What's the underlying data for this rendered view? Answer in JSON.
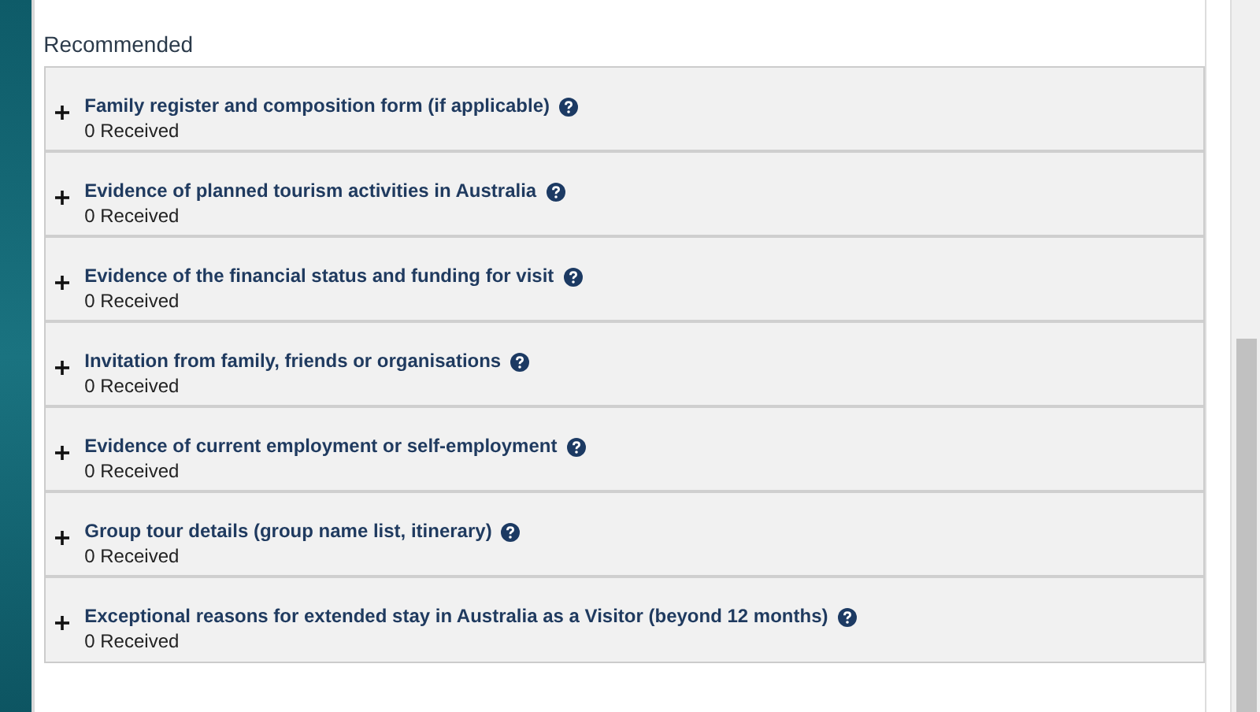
{
  "section": {
    "heading": "Recommended"
  },
  "items": [
    {
      "title": "Family register and composition form (if applicable)",
      "count": "0 Received",
      "expanded": false
    },
    {
      "title": "Evidence of planned tourism activities in Australia",
      "count": "0 Received",
      "expanded": false
    },
    {
      "title": "Evidence of the financial status and funding for visit",
      "count": "0 Received",
      "expanded": false
    },
    {
      "title": "Invitation from family, friends or organisations",
      "count": "0 Received",
      "expanded": false
    },
    {
      "title": "Evidence of current employment or self-employment",
      "count": "0 Received",
      "expanded": false
    },
    {
      "title": "Group tour details (group name list, itinerary)",
      "count": "0 Received",
      "expanded": false
    },
    {
      "title": "Exceptional reasons for extended stay in Australia as a Visitor (beyond 12 months)",
      "count": "0 Received",
      "expanded": false
    }
  ]
}
